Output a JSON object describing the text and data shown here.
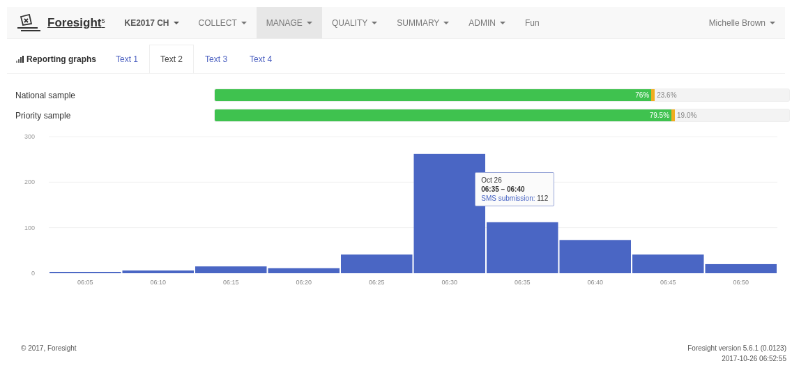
{
  "navbar": {
    "brand": "Foresight",
    "brand_sup": "5",
    "items": [
      {
        "label": "KE2017 CH",
        "caret": true,
        "selected": false,
        "kind": "bold"
      },
      {
        "label": "COLLECT",
        "caret": true,
        "selected": false,
        "kind": "plain"
      },
      {
        "label": "MANAGE",
        "caret": true,
        "selected": true,
        "kind": "plain"
      },
      {
        "label": "QUALITY",
        "caret": true,
        "selected": false,
        "kind": "plain"
      },
      {
        "label": "SUMMARY",
        "caret": true,
        "selected": false,
        "kind": "plain"
      },
      {
        "label": "ADMIN",
        "caret": true,
        "selected": false,
        "kind": "plain"
      },
      {
        "label": "Fun",
        "caret": false,
        "selected": false,
        "kind": "plain"
      }
    ],
    "user": {
      "label": "Michelle Brown",
      "caret": true
    }
  },
  "tabs": {
    "title": "Reporting graphs",
    "items": [
      {
        "label": "Text 1",
        "selected": false
      },
      {
        "label": "Text 2",
        "selected": true
      },
      {
        "label": "Text 3",
        "selected": false
      },
      {
        "label": "Text 4",
        "selected": false
      }
    ]
  },
  "samples": [
    {
      "name": "National sample",
      "segments": [
        {
          "text": "76%",
          "level": 0.76,
          "color": "#3fc24f"
        },
        {
          "level": 0.006,
          "color": "#f0ad1e"
        }
      ],
      "remainder": "23.6%"
    },
    {
      "name": "Priority sample",
      "segments": [
        {
          "text": "79.5%",
          "level": 0.795,
          "color": "#3fc24f"
        },
        {
          "level": 0.006,
          "color": "#f0ad1e"
        }
      ],
      "remainder": "19.0%"
    }
  ],
  "chart": {
    "chart_data": {
      "type": "bar",
      "categories": [
        "06:05",
        "06:10",
        "06:15",
        "06:20",
        "06:25",
        "06:30",
        "06:35",
        "06:40",
        "06:45",
        "06:50"
      ],
      "series": [
        {
          "name": "SMS submission",
          "color": "#4a66c4",
          "values": [
            3,
            6,
            15,
            11,
            41,
            262,
            112,
            73,
            41,
            20
          ]
        }
      ],
      "ylim": [
        0,
        300
      ],
      "yticks": [
        0,
        100,
        200,
        300
      ]
    },
    "tooltip": {
      "date": "Oct 26",
      "range": "06:35 – 06:40",
      "separator": ":",
      "value": "112"
    }
  },
  "footer": {
    "copyright": "© 2017, Foresight",
    "version": "Foresight version 5.6.1 (0.0123)",
    "timestamp": "2017-10-26 06:52:55"
  }
}
